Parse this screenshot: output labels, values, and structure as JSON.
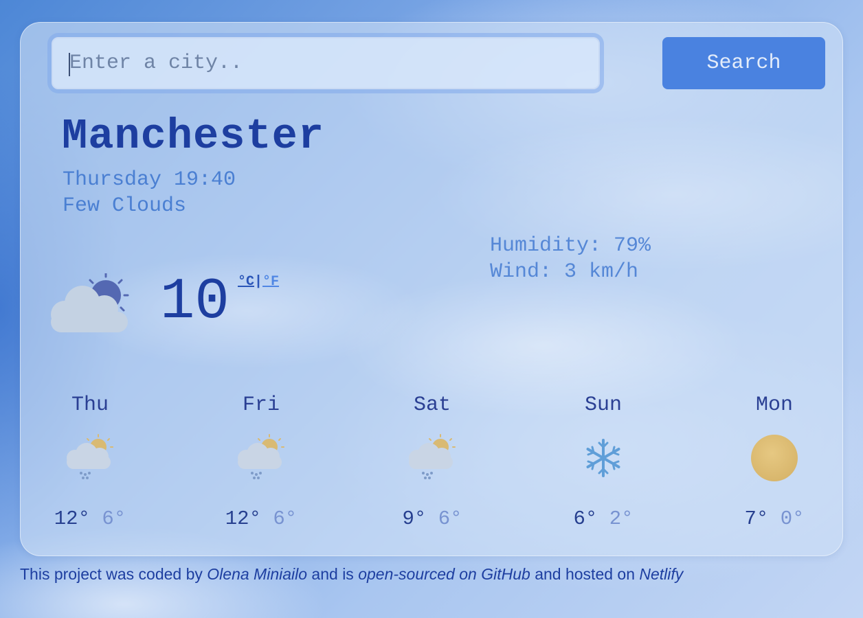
{
  "search": {
    "placeholder": "Enter a city..",
    "button_label": "Search"
  },
  "current": {
    "city": "Manchester",
    "datetime": "Thursday 19:40",
    "description": "Few Clouds",
    "icon": "cloud-sun-icon",
    "temperature": "10",
    "unit_c": "°C",
    "unit_sep": "|",
    "unit_f": "°F",
    "humidity": "Humidity: 79%",
    "wind": "Wind: 3 km/h"
  },
  "forecast": [
    {
      "day": "Thu",
      "icon": "rain-sun-icon",
      "max": "12°",
      "min": "6°"
    },
    {
      "day": "Fri",
      "icon": "rain-sun-icon",
      "max": "12°",
      "min": "6°"
    },
    {
      "day": "Sat",
      "icon": "rain-sun-icon",
      "max": "9°",
      "min": "6°"
    },
    {
      "day": "Sun",
      "icon": "snowflake-icon",
      "max": "6°",
      "min": "2°"
    },
    {
      "day": "Mon",
      "icon": "sun-icon",
      "max": "7°",
      "min": "0°"
    }
  ],
  "footer": {
    "text_1": "This project was coded by ",
    "author": "Olena Miniailo",
    "text_2": " and is ",
    "repo_link": "open-sourced on GitHub",
    "text_3": " and hosted on ",
    "host_link": "Netlify"
  },
  "colors": {
    "accent": "#1d3ea0",
    "button": "#4a82e0",
    "secondary_text": "#4a7fd2"
  }
}
